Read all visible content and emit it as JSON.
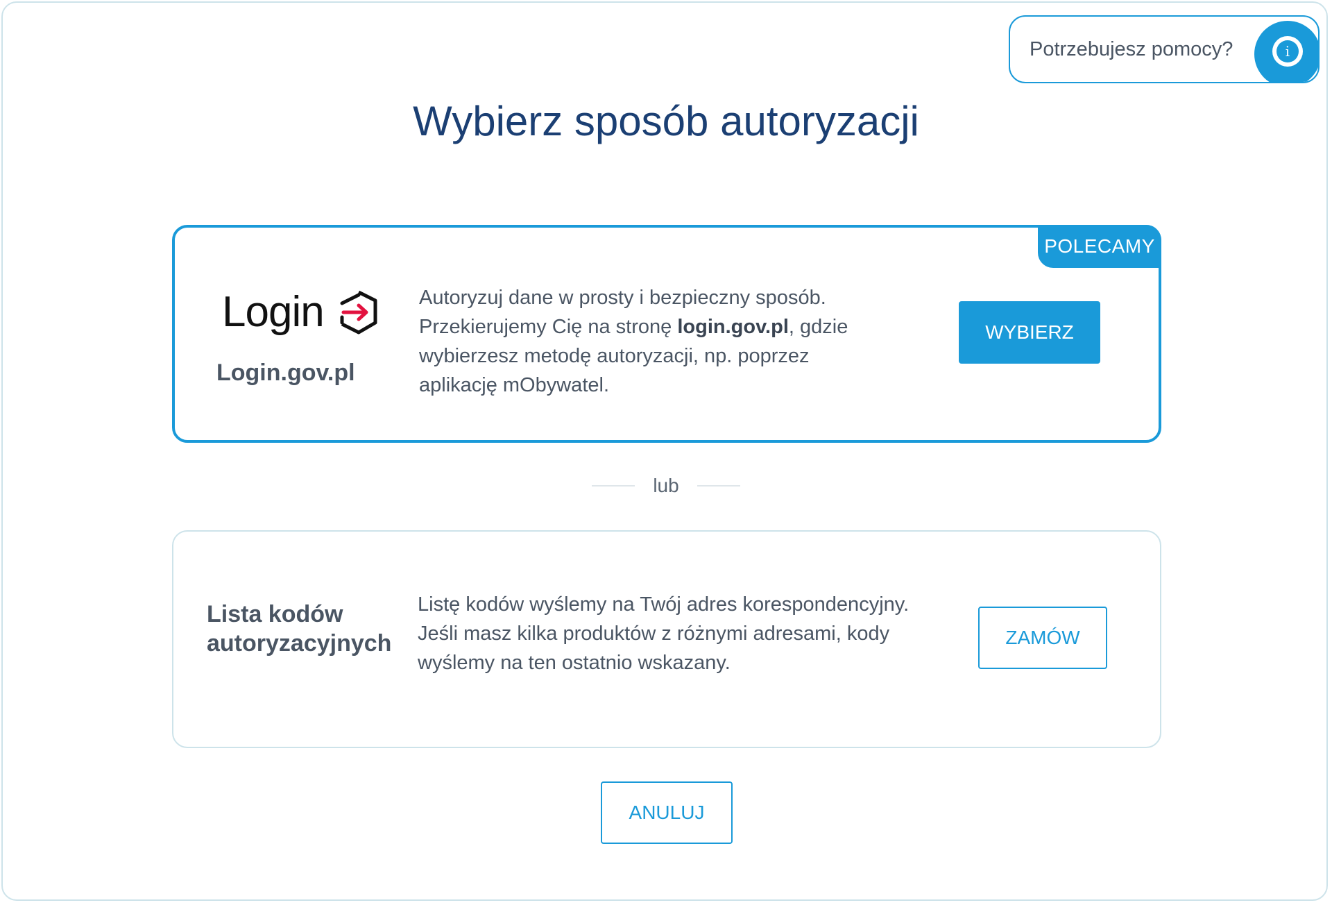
{
  "help": {
    "label": "Potrzebujesz pomocy?",
    "icon": "info-icon"
  },
  "page": {
    "title": "Wybierz sposób autoryzacji"
  },
  "login_option": {
    "badge": "POLECAMY",
    "logo_word": "Login",
    "logo_icon": "login-arrow-icon",
    "provider_name": "Login.gov.pl",
    "description_line1": "Autoryzuj dane w prosty i bezpieczny sposób.",
    "description_pre": "Przekierujemy Cię na stronę ",
    "description_bold": "login.gov.pl",
    "description_post": ", gdzie wybierzesz metodę autoryzacji, np. poprzez aplikację mObywatel.",
    "button_label": "WYBIERZ"
  },
  "separator": {
    "label": "lub"
  },
  "codes_option": {
    "title": "Lista kodów autoryzacyjnych",
    "description": "Listę kodów wyślemy na Twój adres korespondencyjny. Jeśli masz kilka produktów z różnymi adresami, kody wyślemy na ten ostatnio wskazany.",
    "button_label": "ZAMÓW"
  },
  "footer": {
    "cancel_label": "ANULUJ"
  },
  "colors": {
    "accent": "#1a9ad9",
    "title": "#1b3f73",
    "text": "#4a5563",
    "border_light": "#cde3ea",
    "logo_arrow": "#e2123f"
  }
}
